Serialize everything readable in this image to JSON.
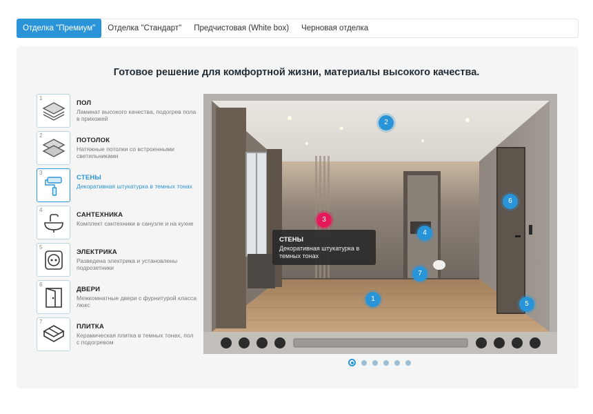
{
  "tabs": [
    {
      "label": "Отделка \"Премиум\"",
      "active": true
    },
    {
      "label": "Отделка \"Стандарт\"",
      "active": false
    },
    {
      "label": "Предчистовая (White box)",
      "active": false
    },
    {
      "label": "Черновая отделка",
      "active": false
    }
  ],
  "headline": "Готовое решение для комфортной жизни, материалы высокого качества.",
  "features": [
    {
      "num": "1",
      "icon": "floor-layers-icon",
      "title": "ПОЛ",
      "desc": "Ламинат высокого качества, подогрев пола в прихожей"
    },
    {
      "num": "2",
      "icon": "ceiling-layers-icon",
      "title": "ПОТОЛОК",
      "desc": "Натяжные потолки со встроенными светильниками"
    },
    {
      "num": "3",
      "icon": "paint-roller-icon",
      "title": "СТЕНЫ",
      "desc": "Декоративная штукатурка в темных тонах",
      "active": true
    },
    {
      "num": "4",
      "icon": "sink-faucet-icon",
      "title": "САНТЕХНИКА",
      "desc": "Комплект сантехники в санузле и на кухне"
    },
    {
      "num": "5",
      "icon": "power-socket-icon",
      "title": "ЭЛЕКТРИКА",
      "desc": "Разведена электрика и установлены подрозетники"
    },
    {
      "num": "6",
      "icon": "door-icon",
      "title": "ДВЕРИ",
      "desc": "Межкомнатные двери с фурнитурой класса люкс"
    },
    {
      "num": "7",
      "icon": "tiles-icon",
      "title": "ПЛИТКА",
      "desc": "Керамическая плитка в темных тонах, пол с подогревом"
    }
  ],
  "hotspots": [
    "1",
    "2",
    "3",
    "4",
    "5",
    "6",
    "7"
  ],
  "tooltip": {
    "title": "СТЕНЫ",
    "desc": "Декоративная штукатурка в темных тонах"
  },
  "colors": {
    "accent": "#2a94d8",
    "highlight": "#e6195a",
    "panel": "#f5f5f5"
  },
  "slides": {
    "count": 6,
    "active": 1
  }
}
